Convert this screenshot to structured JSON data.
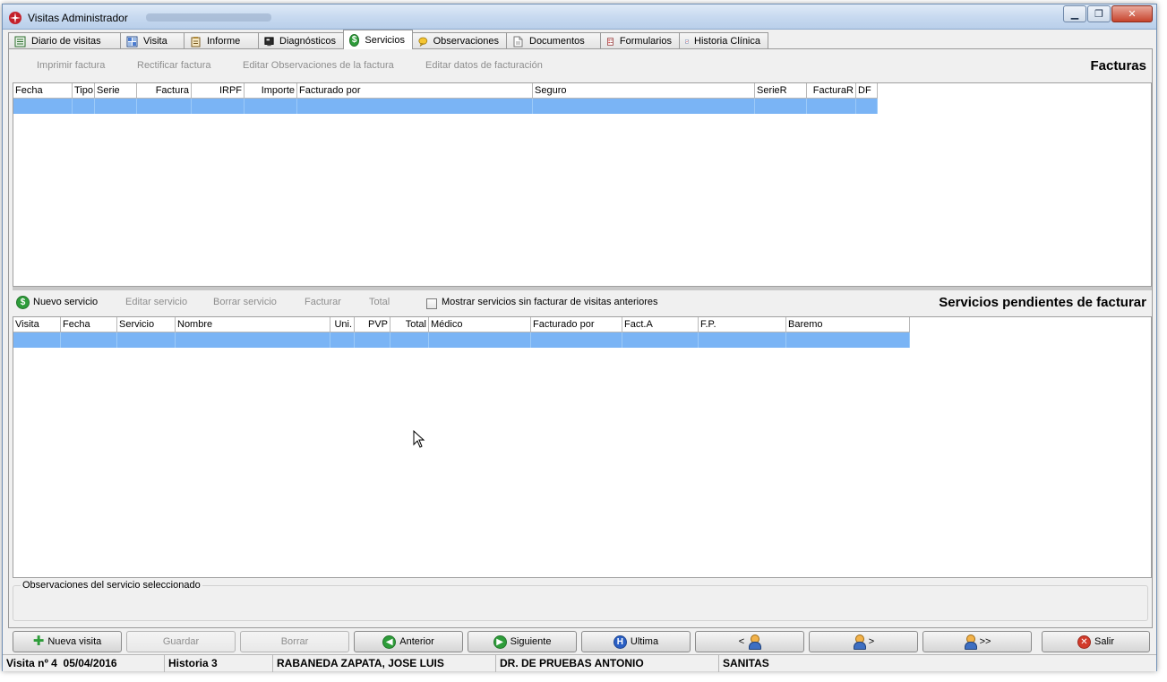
{
  "window": {
    "title": "Visitas Administrador"
  },
  "tabs": [
    {
      "label": "Diario de visitas",
      "icon": "list-icon"
    },
    {
      "label": "Visita",
      "icon": "grid-icon"
    },
    {
      "label": "Informe",
      "icon": "clipboard-icon"
    },
    {
      "label": "Diagnósticos",
      "icon": "monitor-icon"
    },
    {
      "label": "Servicios",
      "icon": "dollar-icon",
      "active": true
    },
    {
      "label": "Observaciones",
      "icon": "speech-icon"
    },
    {
      "label": "Documentos",
      "icon": "document-icon"
    },
    {
      "label": "Formularios",
      "icon": "form-icon"
    },
    {
      "label": "Historia Clínica",
      "icon": "chart-icon"
    }
  ],
  "facturas": {
    "title": "Facturas",
    "toolbar": {
      "imprimir": "Imprimir factura",
      "rectificar": "Rectificar factura",
      "editar_obs": "Editar Observaciones de la factura",
      "editar_datos": "Editar datos de facturación"
    },
    "columns": [
      "Fecha",
      "Tipo",
      "Serie",
      "Factura",
      "IRPF",
      "Importe",
      "Facturado por",
      "Seguro",
      "SerieR",
      "FacturaR",
      "DF"
    ]
  },
  "servicios": {
    "title": "Servicios pendientes de facturar",
    "toolbar": {
      "nuevo": "Nuevo servicio",
      "editar": "Editar servicio",
      "borrar": "Borrar servicio",
      "facturar": "Facturar",
      "total": "Total",
      "mostrar": "Mostrar servicios sin facturar de visitas anteriores"
    },
    "mostrar_checked": false,
    "columns": [
      "Visita",
      "Fecha",
      "Servicio",
      "Nombre",
      "Uni.",
      "PVP",
      "Total",
      "Médico",
      "Facturado por",
      "Fact.A",
      "F.P.",
      "Baremo"
    ]
  },
  "observaciones": {
    "label": "Observaciones del servicio seleccionado"
  },
  "buttons": {
    "nueva_visita": "Nueva visita",
    "guardar": "Guardar",
    "borrar": "Borrar",
    "anterior": "Anterior",
    "siguiente": "Siguiente",
    "ultima": "Ultima",
    "prev_patient": "<",
    "next_patient": ">",
    "last_patient": ">>",
    "salir": "Salir"
  },
  "status": {
    "visita": "Visita nº 4",
    "fecha": "05/04/2016",
    "historia": "Historia 3",
    "paciente": "RABANEDA ZAPATA, JOSE LUIS",
    "medico": "DR. DE PRUEBAS ANTONIO",
    "seguro": "SANITAS"
  },
  "colors": {
    "selection": "#7ab4f5",
    "accent_green": "#2e9d3a",
    "accent_red": "#d23a2a",
    "accent_blue": "#2a5fc4"
  }
}
